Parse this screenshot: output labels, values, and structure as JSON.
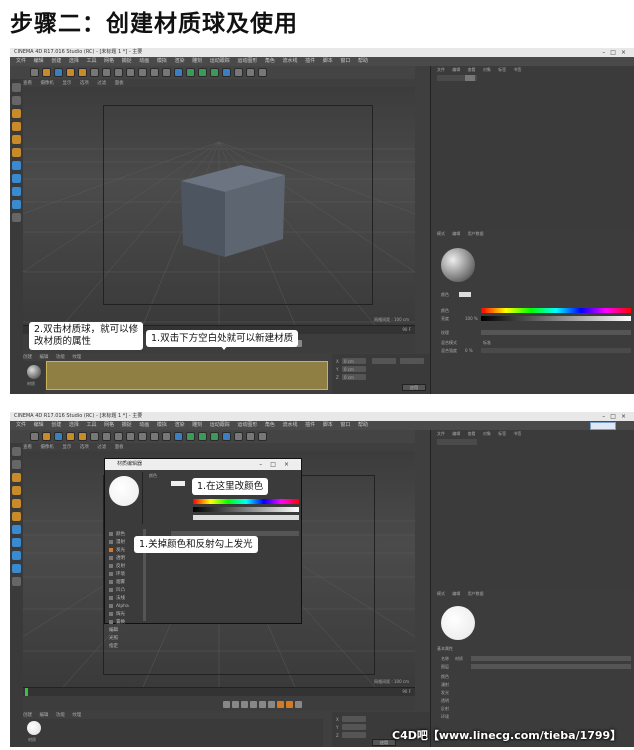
{
  "page_title": "步骤二：创建材质球及使用",
  "app": {
    "window_title": "CINEMA 4D R17.016 Studio (RC) - [未标题 1 *] - 主要",
    "menu": [
      "文件",
      "编辑",
      "创建",
      "选择",
      "工具",
      "网格",
      "捕捉",
      "动画",
      "模拟",
      "渲染",
      "雕刻",
      "运动跟踪",
      "运动图形",
      "角色",
      "流水线",
      "插件",
      "脚本",
      "窗口",
      "帮助"
    ],
    "viewport_menu": [
      "查看",
      "摄像机",
      "显示",
      "选项",
      "过滤",
      "面板"
    ],
    "viewport_label": "透视视图",
    "grid_label": "网格间距 : 100 cm",
    "material_menu": [
      "创建",
      "编辑",
      "功能",
      "纹理"
    ],
    "object_tabs": [
      "文件",
      "编辑",
      "查看",
      "对象",
      "标签",
      "书签"
    ],
    "attr_tabs": [
      "模式",
      "编辑",
      "用户数据"
    ],
    "coord_labels": [
      "X",
      "Y",
      "Z"
    ],
    "coord_values": [
      "0 cm",
      "0 cm",
      "0 cm"
    ],
    "apply_label": "应用",
    "timeline_end": "90 F"
  },
  "panel_top": {
    "callout_material": "2.双击材质球，就可以修\n改材质的属性",
    "callout_new": "1.双击下方空白处就可以新建材质",
    "material_name": "材质",
    "attr_section": "颜色",
    "attr_rows": [
      "颜色",
      "亮度",
      "纹理",
      "混合模式",
      "混合强度"
    ],
    "attr_values": [
      "100 %",
      "",
      "",
      "标准",
      "0 %"
    ]
  },
  "panel_bottom": {
    "dialog_title": "材质编辑器",
    "callout_color": "1.在这里改颜色",
    "callout_channels": "1.关掉颜色和反射勾上发光",
    "dialog_section": "颜色",
    "channels": [
      "颜色",
      "漫射",
      "发光",
      "透明",
      "反射",
      "环境",
      "烟雾",
      "凹凸",
      "法线",
      "Alpha",
      "辉光",
      "置换",
      "编辑",
      "光照",
      "指定"
    ],
    "material_section": "基本属性",
    "material_props": [
      "名称",
      "图层",
      "颜色",
      "漫射",
      "发光",
      "透明",
      "反射",
      "环境"
    ],
    "name_value": "材质"
  },
  "watermark": "C4D吧【www.linecg.com/tieba/1799】",
  "colors": {
    "accent_orange": "#d47a25",
    "ui_dark": "#3f3f3f",
    "timeline_material_fill": "#8f7f42"
  }
}
